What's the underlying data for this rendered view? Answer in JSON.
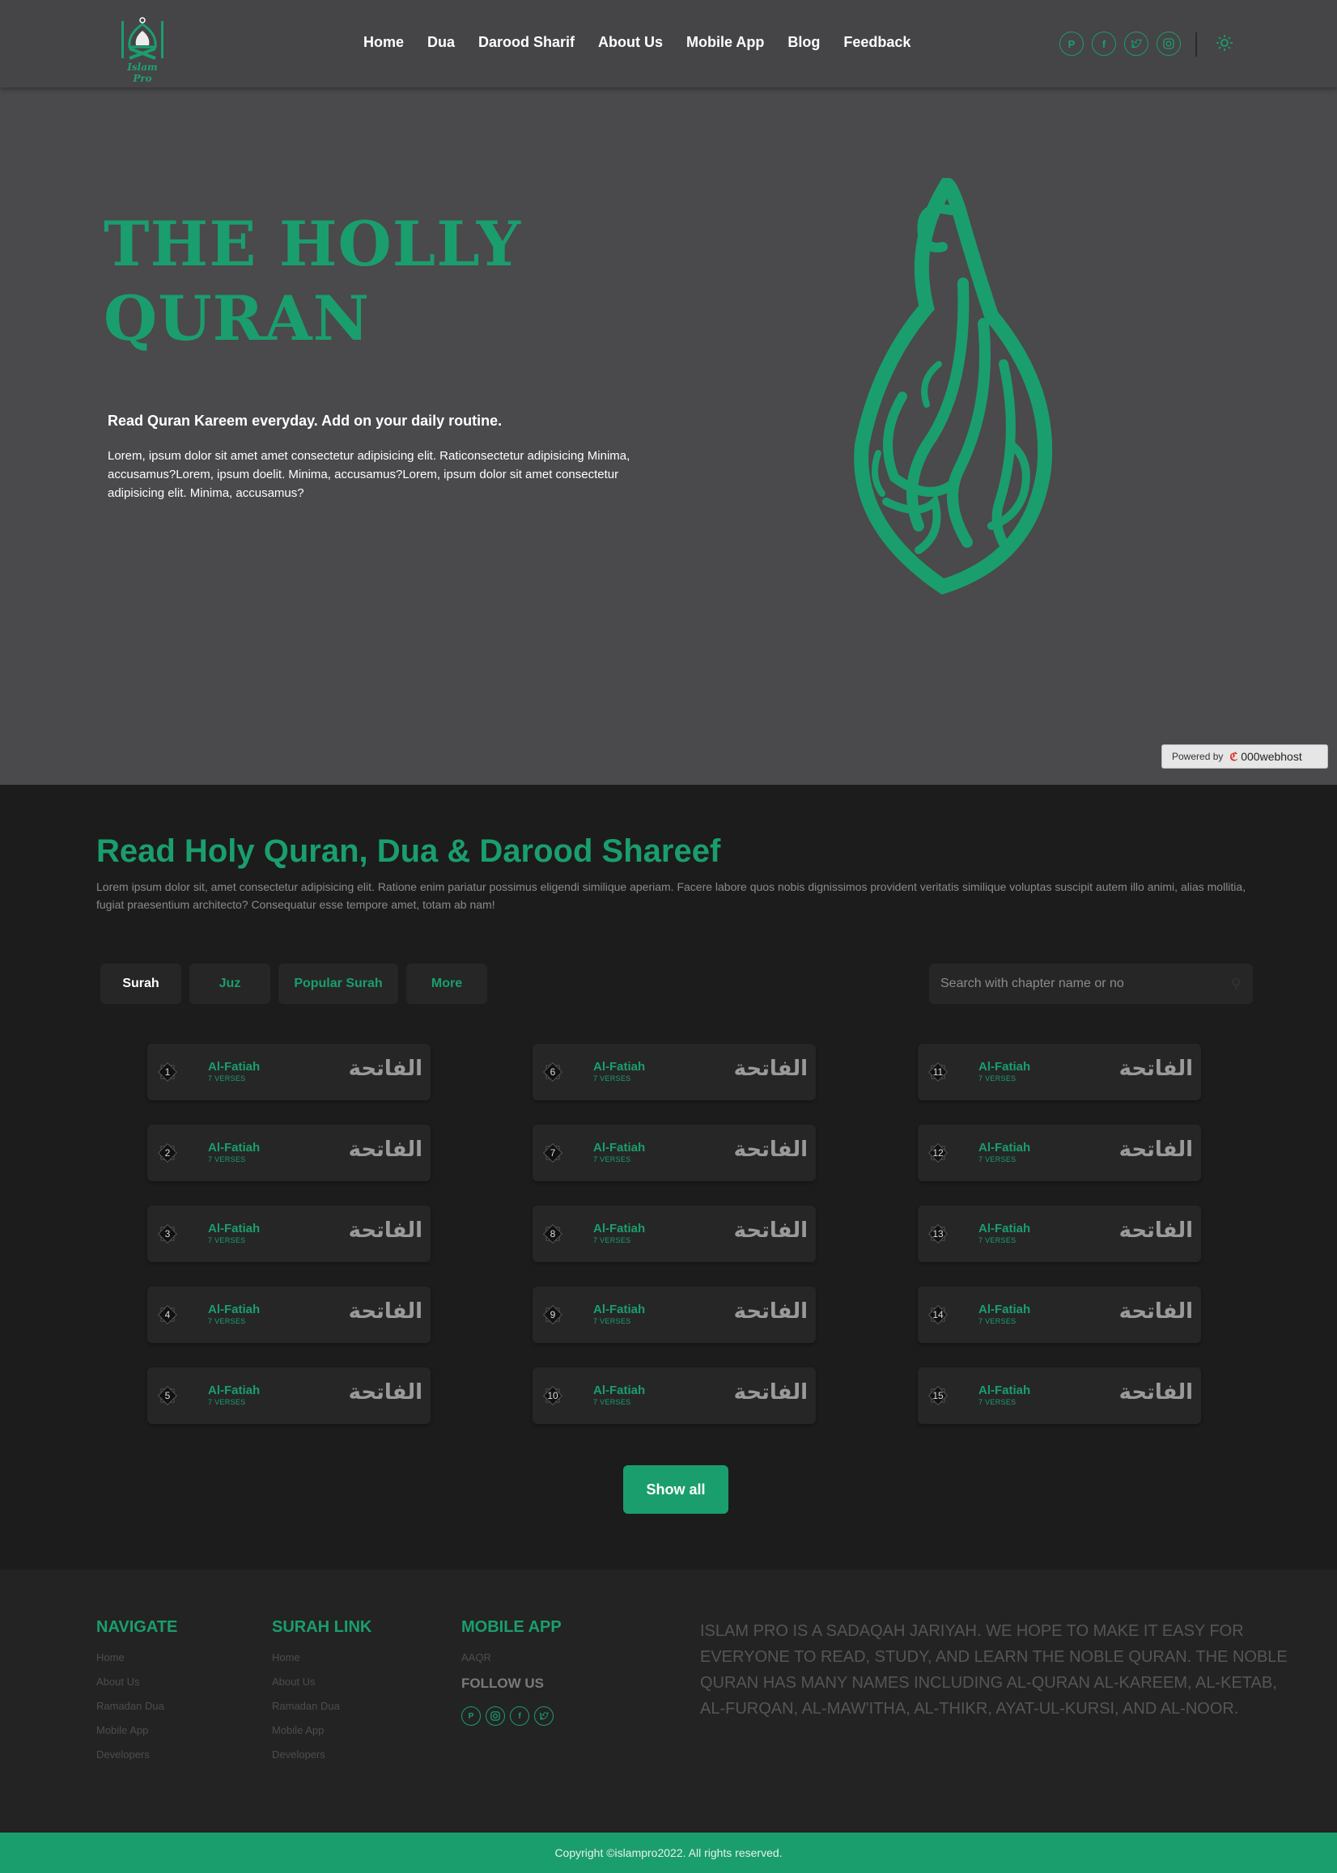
{
  "header": {
    "logo_text": "Islam Pro",
    "nav": [
      "Home",
      "Dua",
      "Darood Sharif",
      "About Us",
      "Mobile App",
      "Blog",
      "Feedback"
    ],
    "socials": [
      "pinterest-icon",
      "facebook-icon",
      "twitter-icon",
      "instagram-icon"
    ],
    "theme_icon": "sun-icon",
    "accent_color": "#1a9e6d"
  },
  "hero": {
    "title_line1": "THE HOLLY",
    "title_line2": "QURAN",
    "subtitle": "Read Quran Kareem everyday. Add on your daily routine.",
    "body": "Lorem, ipsum dolor sit amet amet consectetur adipisicing elit. Raticonsectetur adipisicing Minima, accusamus?Lorem, ipsum doelit. Minima, accusamus?Lorem, ipsum dolor sit amet consectetur adipisicing elit. Minima, accusamus?",
    "powered_label": "Powered by",
    "powered_brand": "000webhost"
  },
  "read": {
    "title": "Read Holy Quran, Dua & Darood Shareef",
    "description": "Lorem ipsum dolor sit, amet consectetur adipisicing elit. Ratione enim pariatur possimus eligendi similique aperiam. Facere labore quos nobis dignissimos provident veritatis similique voluptas suscipit autem illo animi, alias mollitia, fugiat praesentium architecto? Consequatur esse tempore amet, totam ab nam!",
    "tabs": [
      {
        "label": "Surah",
        "active": true
      },
      {
        "label": "Juz",
        "active": false
      },
      {
        "label": "Popular Surah",
        "active": false
      },
      {
        "label": "More",
        "active": false
      }
    ],
    "search_placeholder": "Search with chapter name or no",
    "surahs": [
      {
        "num": "1",
        "name": "Al-Fatiah",
        "verses": "7 VERSES",
        "arabic": "الفاتحة"
      },
      {
        "num": "6",
        "name": "Al-Fatiah",
        "verses": "7 VERSES",
        "arabic": "الفاتحة"
      },
      {
        "num": "11",
        "name": "Al-Fatiah",
        "verses": "7 VERSES",
        "arabic": "الفاتحة"
      },
      {
        "num": "2",
        "name": "Al-Fatiah",
        "verses": "7 VERSES",
        "arabic": "الفاتحة"
      },
      {
        "num": "7",
        "name": "Al-Fatiah",
        "verses": "7 VERSES",
        "arabic": "الفاتحة"
      },
      {
        "num": "12",
        "name": "Al-Fatiah",
        "verses": "7 VERSES",
        "arabic": "الفاتحة"
      },
      {
        "num": "3",
        "name": "Al-Fatiah",
        "verses": "7 VERSES",
        "arabic": "الفاتحة"
      },
      {
        "num": "8",
        "name": "Al-Fatiah",
        "verses": "7 VERSES",
        "arabic": "الفاتحة"
      },
      {
        "num": "13",
        "name": "Al-Fatiah",
        "verses": "7 VERSES",
        "arabic": "الفاتحة"
      },
      {
        "num": "4",
        "name": "Al-Fatiah",
        "verses": "7 VERSES",
        "arabic": "الفاتحة"
      },
      {
        "num": "9",
        "name": "Al-Fatiah",
        "verses": "7 VERSES",
        "arabic": "الفاتحة"
      },
      {
        "num": "14",
        "name": "Al-Fatiah",
        "verses": "7 VERSES",
        "arabic": "الفاتحة"
      },
      {
        "num": "5",
        "name": "Al-Fatiah",
        "verses": "7 VERSES",
        "arabic": "الفاتحة"
      },
      {
        "num": "10",
        "name": "Al-Fatiah",
        "verses": "7 VERSES",
        "arabic": "الفاتحة"
      },
      {
        "num": "15",
        "name": "Al-Fatiah",
        "verses": "7 VERSES",
        "arabic": "الفاتحة"
      }
    ],
    "show_all": "Show all"
  },
  "footer": {
    "navigate_title": "NAVIGATE",
    "navigate_links": [
      "Home",
      "About Us",
      "Ramadan Dua",
      "Mobile App",
      "Developers"
    ],
    "surah_title": "SURAH LINK",
    "surah_links": [
      "Home",
      "About Us",
      "Ramadan Dua",
      "Mobile App",
      "Developers"
    ],
    "app_title": "MOBILE APP",
    "app_link": "AAQR",
    "follow_title": "FOLLOW US",
    "follow_icons": [
      "pinterest-icon",
      "instagram-icon",
      "facebook-icon",
      "twitter-icon"
    ],
    "about": "Islam pro is a sadaqah jariyah. We hope to make it easy for everyone to read, study, and learn the noble Quran. The noble Quran has many names including al-Quran al-Kareem, al-Ketab, al-Furqan, al-Maw'itha, al-Thikr, Ayat-ul-Kursi, and al-Noor.",
    "copyright": "Copyright ©islampro2022. All rights reserved."
  }
}
